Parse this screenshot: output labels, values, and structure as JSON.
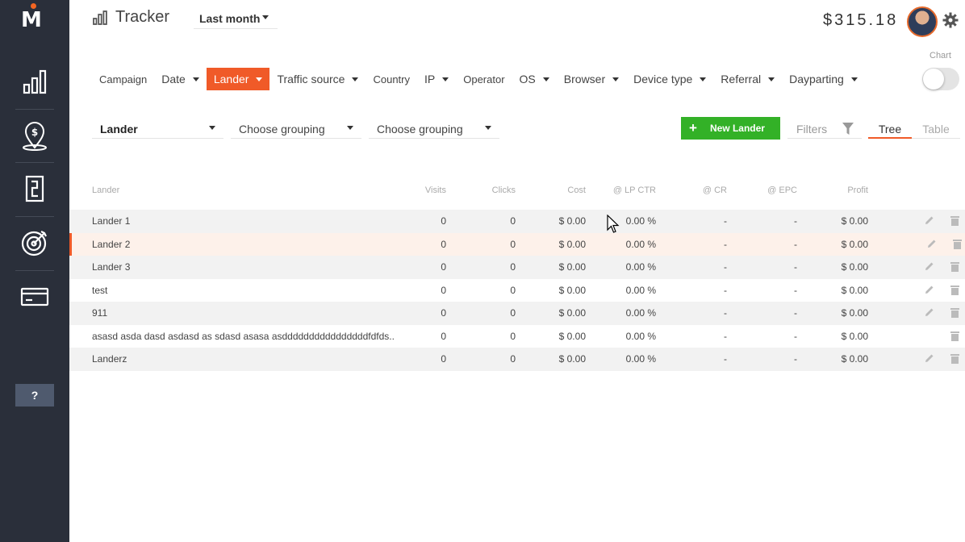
{
  "header": {
    "title": "Tracker",
    "period": "Last month",
    "balance": "$315.18",
    "chart_label": "Chart"
  },
  "sidebar": {
    "items": [
      {
        "name": "stats-icon"
      },
      {
        "name": "money-pin-icon"
      },
      {
        "name": "lander-icon"
      },
      {
        "name": "target-icon"
      },
      {
        "name": "card-icon"
      }
    ],
    "help": "?"
  },
  "tabs": [
    {
      "label": "Campaign",
      "caret": false
    },
    {
      "label": "Date",
      "caret": true
    },
    {
      "label": "Lander",
      "caret": true,
      "active": true
    },
    {
      "label": "Traffic source",
      "caret": true
    },
    {
      "label": "Country",
      "caret": false
    },
    {
      "label": "IP",
      "caret": true
    },
    {
      "label": "Operator",
      "caret": false
    },
    {
      "label": "OS",
      "caret": true
    },
    {
      "label": "Browser",
      "caret": true
    },
    {
      "label": "Device type",
      "caret": true
    },
    {
      "label": "Referral",
      "caret": true
    },
    {
      "label": "Dayparting",
      "caret": true
    }
  ],
  "grouping": {
    "first": "Lander",
    "second": "Choose grouping",
    "third": "Choose grouping"
  },
  "toolbar": {
    "new_lander": "New Lander",
    "filters": "Filters",
    "tree": "Tree",
    "table": "Table"
  },
  "table": {
    "columns": [
      "Lander",
      "Visits",
      "Clicks",
      "Cost",
      "@ LP CTR",
      "@ CR",
      "@ EPC",
      "Profit"
    ],
    "rows": [
      {
        "name": "Lander 1",
        "visits": "0",
        "clicks": "0",
        "cost": "$ 0.00",
        "lp_ctr": "0.00 %",
        "cr": "-",
        "epc": "-",
        "profit": "$ 0.00",
        "editable": true
      },
      {
        "name": "Lander 2",
        "visits": "0",
        "clicks": "0",
        "cost": "$ 0.00",
        "lp_ctr": "0.00 %",
        "cr": "-",
        "epc": "-",
        "profit": "$ 0.00",
        "editable": true,
        "selected": true
      },
      {
        "name": "Lander 3",
        "visits": "0",
        "clicks": "0",
        "cost": "$ 0.00",
        "lp_ctr": "0.00 %",
        "cr": "-",
        "epc": "-",
        "profit": "$ 0.00",
        "editable": true
      },
      {
        "name": "test",
        "visits": "0",
        "clicks": "0",
        "cost": "$ 0.00",
        "lp_ctr": "0.00 %",
        "cr": "-",
        "epc": "-",
        "profit": "$ 0.00",
        "editable": true
      },
      {
        "name": "911",
        "visits": "0",
        "clicks": "0",
        "cost": "$ 0.00",
        "lp_ctr": "0.00 %",
        "cr": "-",
        "epc": "-",
        "profit": "$ 0.00",
        "editable": true
      },
      {
        "name": "asasd asda dasd asdasd as sdasd asasa asddddddddddddddddfdfds..",
        "visits": "0",
        "clicks": "0",
        "cost": "$ 0.00",
        "lp_ctr": "0.00 %",
        "cr": "-",
        "epc": "-",
        "profit": "$ 0.00",
        "editable": false
      },
      {
        "name": "Landerz",
        "visits": "0",
        "clicks": "0",
        "cost": "$ 0.00",
        "lp_ctr": "0.00 %",
        "cr": "-",
        "epc": "-",
        "profit": "$ 0.00",
        "editable": true
      }
    ]
  },
  "colors": {
    "sidebar": "#2a2f3a",
    "accent": "#f05a28",
    "new_button": "#33b127"
  }
}
